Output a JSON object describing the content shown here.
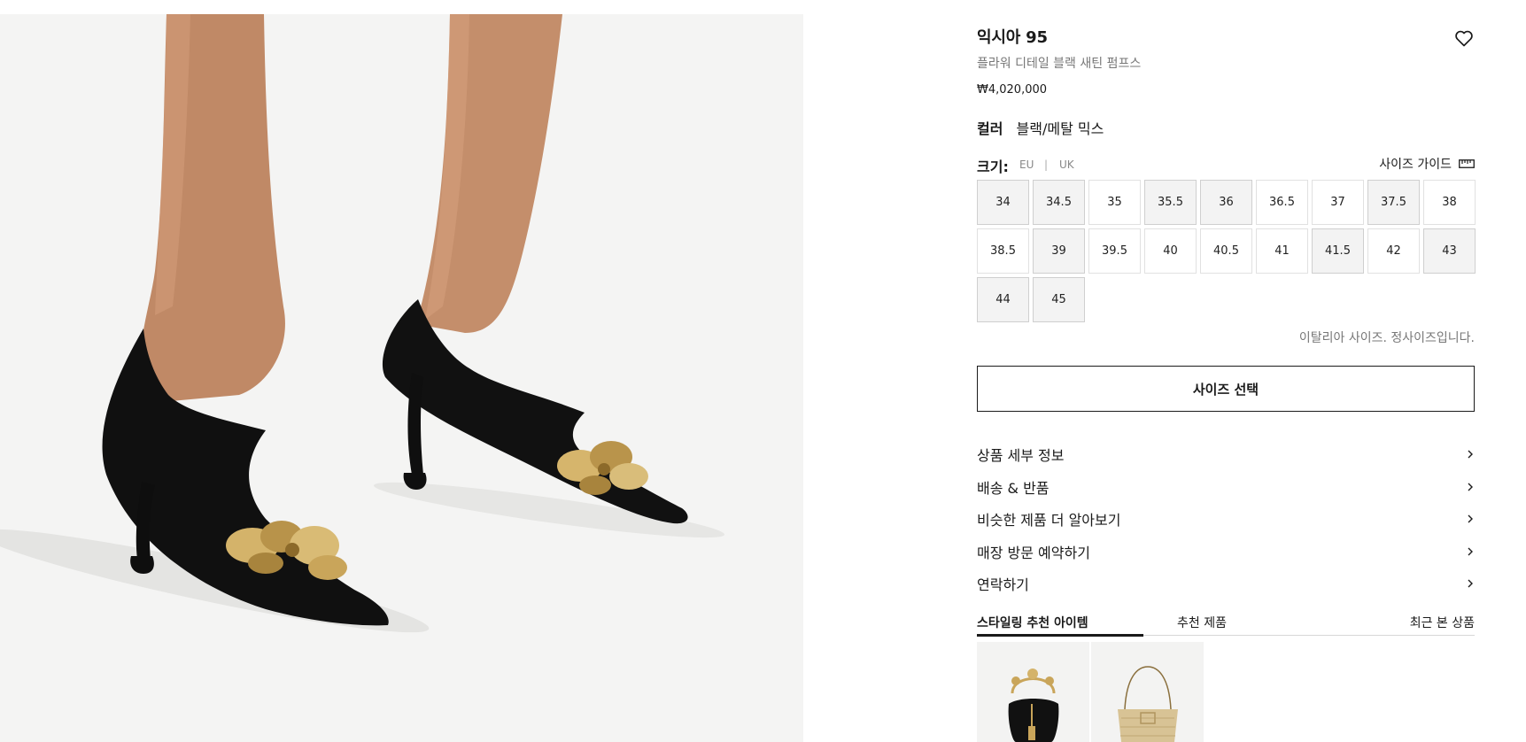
{
  "product": {
    "title": "익시아 95",
    "subtitle": "플라워 디테일 블랙 새틴 펌프스",
    "price": "₩4,020,000",
    "color_label": "컬러",
    "color_value": "블랙/메탈 믹스",
    "hero_image": "black-satin-pumps-with-gold-flowers-photo"
  },
  "sizes": {
    "label": "크기:",
    "unit_eu": "EU",
    "unit_sep": "|",
    "unit_uk": "UK",
    "guide_label": "사이즈 가이드",
    "guide_icon": "ruler-icon",
    "items": [
      {
        "label": "34",
        "available": false
      },
      {
        "label": "34.5",
        "available": false
      },
      {
        "label": "35",
        "available": true
      },
      {
        "label": "35.5",
        "available": false
      },
      {
        "label": "36",
        "available": false
      },
      {
        "label": "36.5",
        "available": true
      },
      {
        "label": "37",
        "available": true
      },
      {
        "label": "37.5",
        "available": false
      },
      {
        "label": "38",
        "available": true
      },
      {
        "label": "38.5",
        "available": true
      },
      {
        "label": "39",
        "available": false
      },
      {
        "label": "39.5",
        "available": true
      },
      {
        "label": "40",
        "available": true
      },
      {
        "label": "40.5",
        "available": true
      },
      {
        "label": "41",
        "available": true
      },
      {
        "label": "41.5",
        "available": false
      },
      {
        "label": "42",
        "available": true
      },
      {
        "label": "43",
        "available": false
      },
      {
        "label": "44",
        "available": false
      },
      {
        "label": "45",
        "available": false
      }
    ],
    "fit_note": "이탈리아 사이즈. 정사이즈입니다."
  },
  "select_button": "사이즈 선택",
  "accordion": [
    {
      "label": "상품 세부 정보"
    },
    {
      "label": "배송 & 반품"
    },
    {
      "label": "비슷한 제품 더 알아보기"
    },
    {
      "label": "매장 방문 예약하기"
    },
    {
      "label": "연락하기"
    }
  ],
  "recommendations": {
    "tabs": [
      {
        "label": "스타일링 추천 아이템",
        "active": true
      },
      {
        "label": "추천 제품",
        "active": false
      },
      {
        "label": "최근 본 상품",
        "active": false
      }
    ],
    "items": [
      {
        "image": "black-bucket-bag-with-gold-flower-handle"
      },
      {
        "image": "gold-quilted-shoulder-bag"
      }
    ]
  },
  "colors": {
    "accent": "#1a1a1a",
    "muted_text": "#777777",
    "unavailable_bg": "#f3f3f3",
    "hero_bg": "#f4f4f3"
  }
}
